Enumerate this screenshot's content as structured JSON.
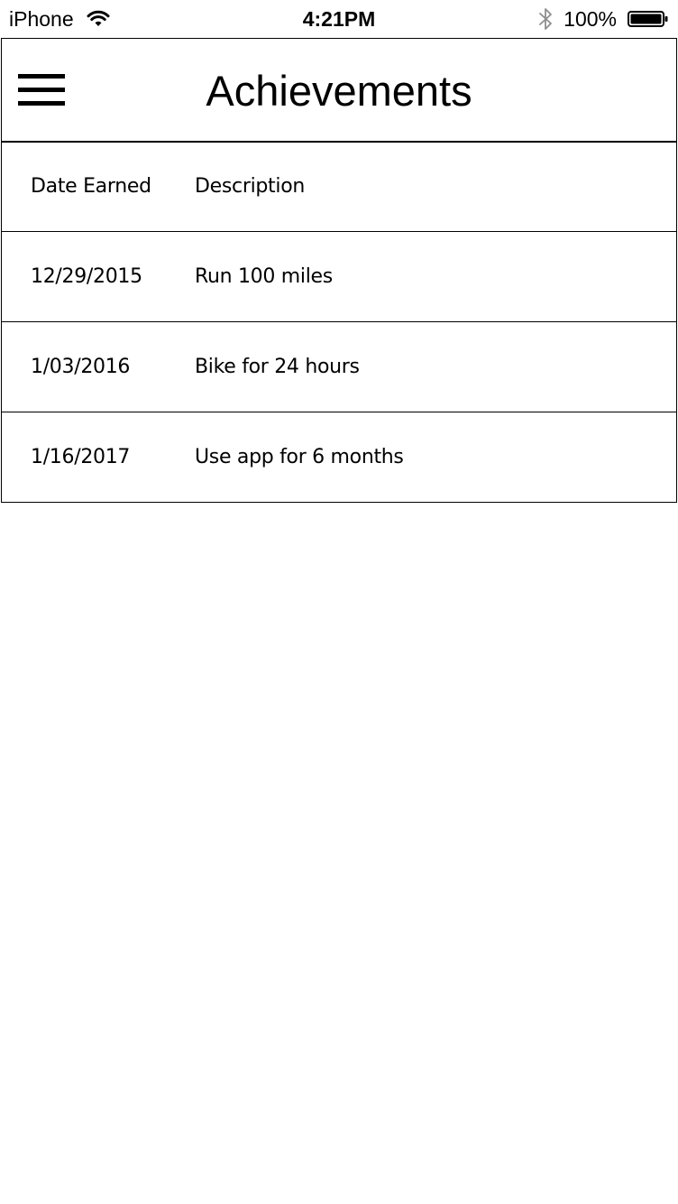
{
  "status_bar": {
    "carrier": "iPhone",
    "time": "4:21PM",
    "battery_percent": "100%",
    "icons": [
      "wifi-icon",
      "bluetooth-icon",
      "battery-icon"
    ]
  },
  "header": {
    "title": "Achievements",
    "menu_icon": "hamburger-menu-icon"
  },
  "table": {
    "columns": [
      "Date Earned",
      "Description"
    ],
    "rows": [
      {
        "date": "12/29/2015",
        "description": "Run 100 miles"
      },
      {
        "date": "1/03/2016",
        "description": "Bike for 24 hours"
      },
      {
        "date": "1/16/2017",
        "description": "Use app for 6 months"
      }
    ]
  },
  "colors": {
    "background": "#ffffff",
    "text": "#000000",
    "border": "#000000",
    "bluetooth": "#8e8e8e"
  }
}
